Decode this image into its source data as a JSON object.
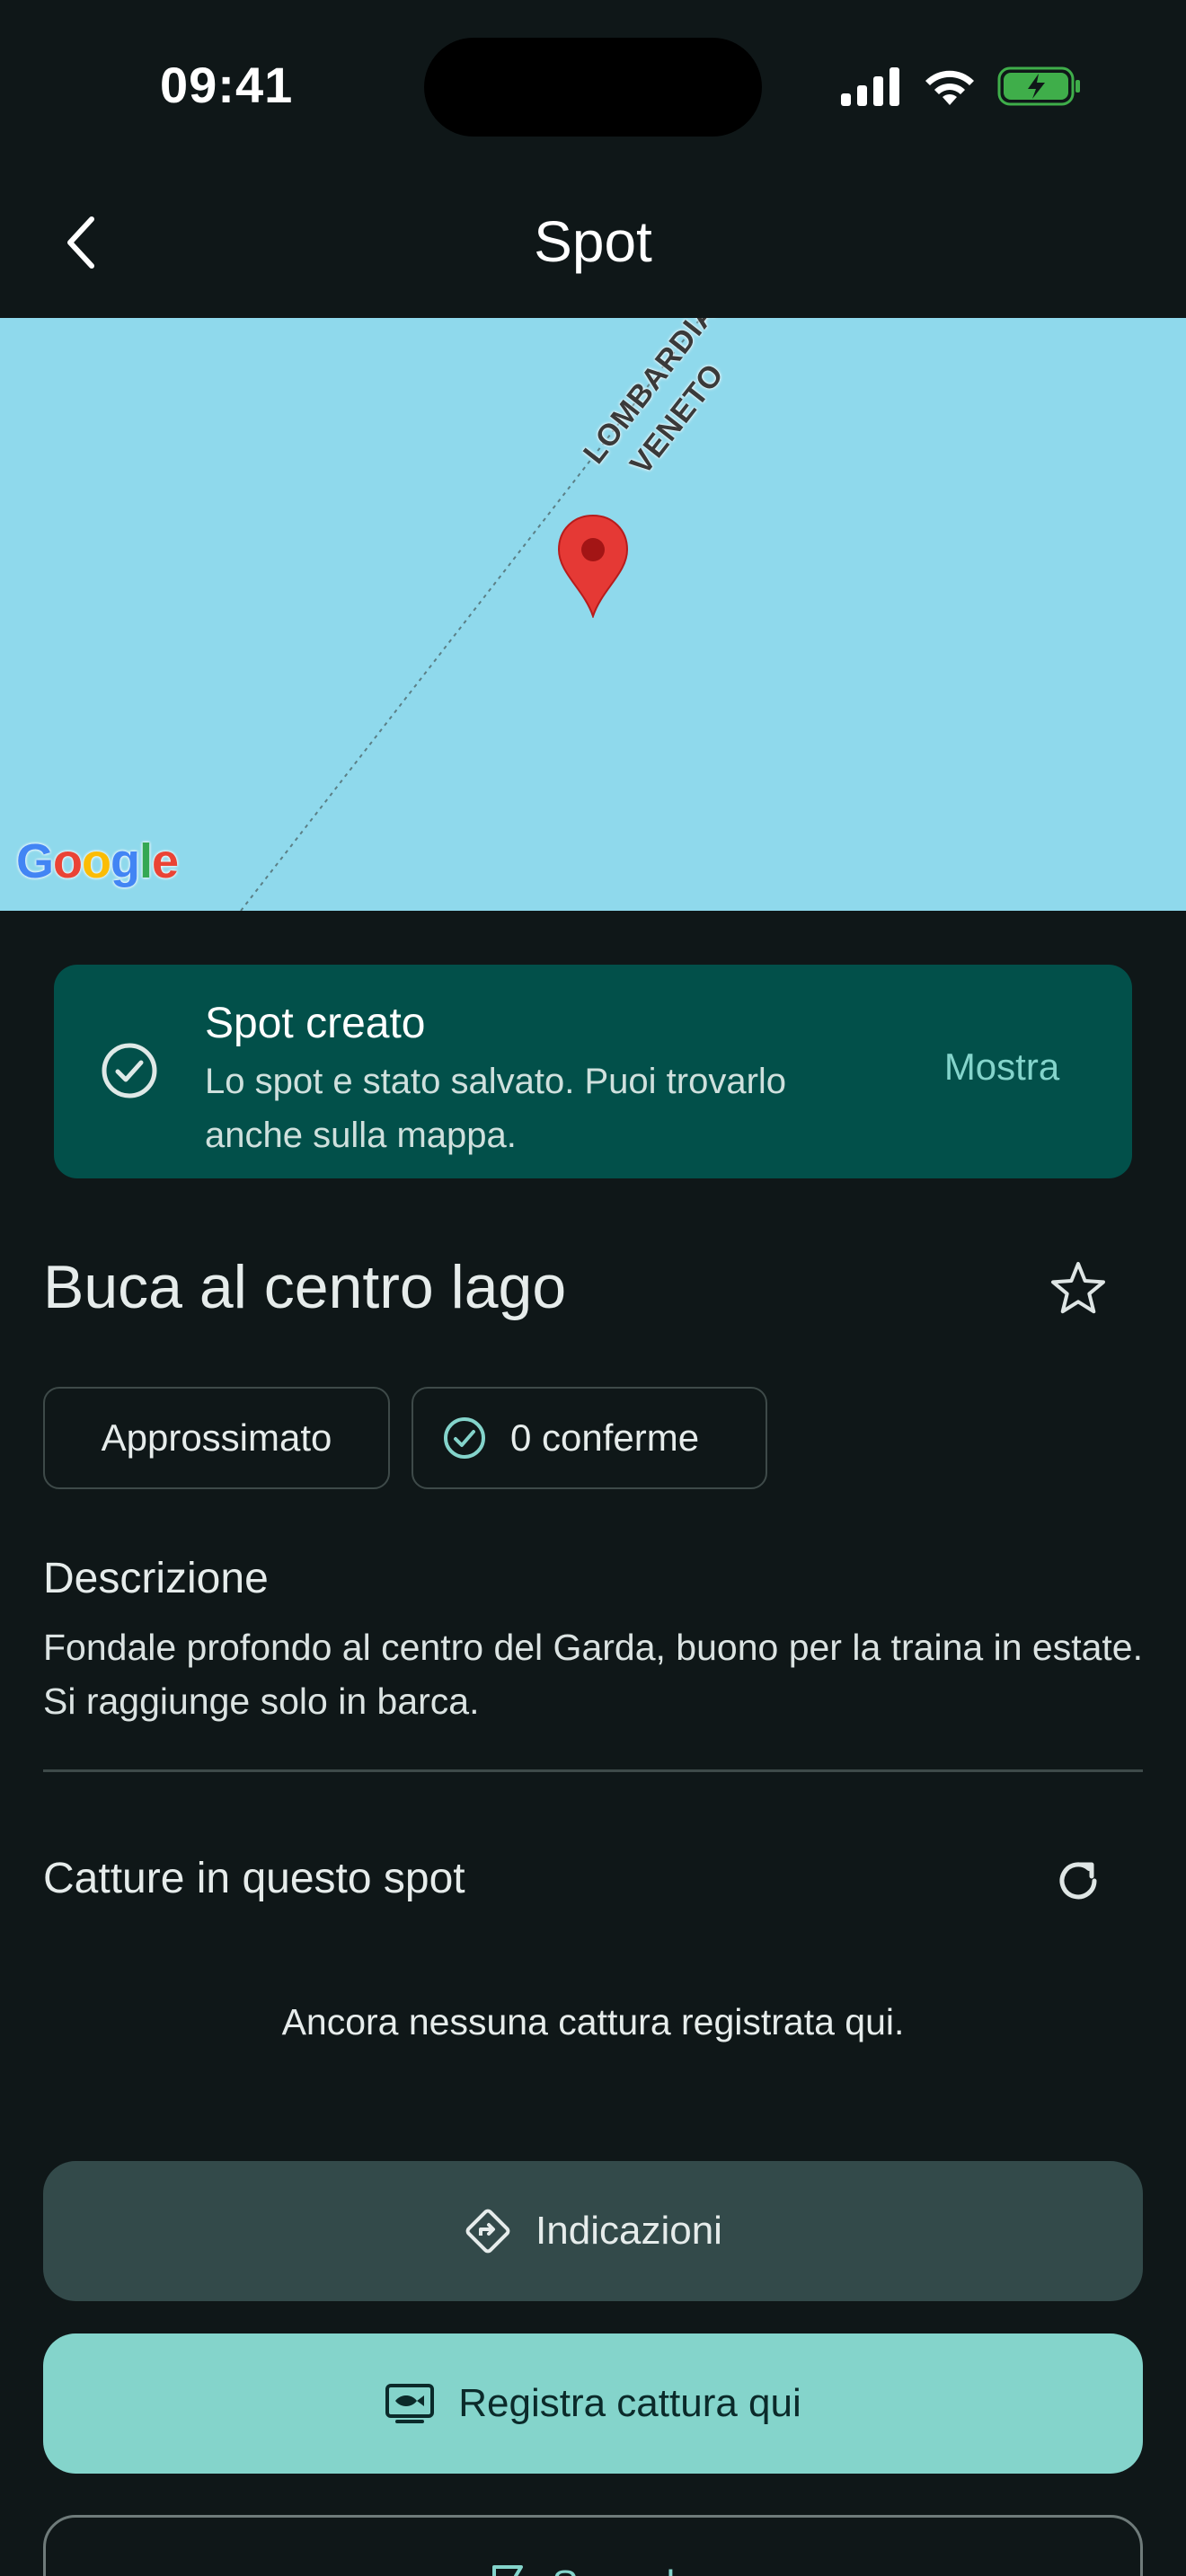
{
  "status_bar": {
    "time": "09:41"
  },
  "header": {
    "title": "Spot"
  },
  "map": {
    "region_labels": [
      "LOMBARDIA",
      "VENETO"
    ],
    "water_color": "#8fd9ec",
    "pin_color": "#e53935",
    "google_logo": "Google"
  },
  "snackbar": {
    "title": "Spot creato",
    "body": "Lo spot e stato salvato. Puoi trovarlo anche sulla mappa.",
    "action": "Mostra",
    "background": "#02504a"
  },
  "spot": {
    "title": "Buca al centro lago",
    "chips": {
      "accuracy": "Approssimato",
      "confirmations": "0 conferme"
    },
    "description_label": "Descrizione",
    "description": "Fondale profondo al centro del Garda, buono per la traina in estate. Si raggiunge solo in barca."
  },
  "catches": {
    "label": "Catture in questo spot",
    "empty": "Ancora nessuna cattura registrata qui."
  },
  "actions": {
    "directions": "Indicazioni",
    "register_catch": "Registra cattura qui",
    "report": "Segnala"
  },
  "colors": {
    "background": "#0f1718",
    "accent": "#84d4cb",
    "secondary_button": "#334a4a"
  }
}
